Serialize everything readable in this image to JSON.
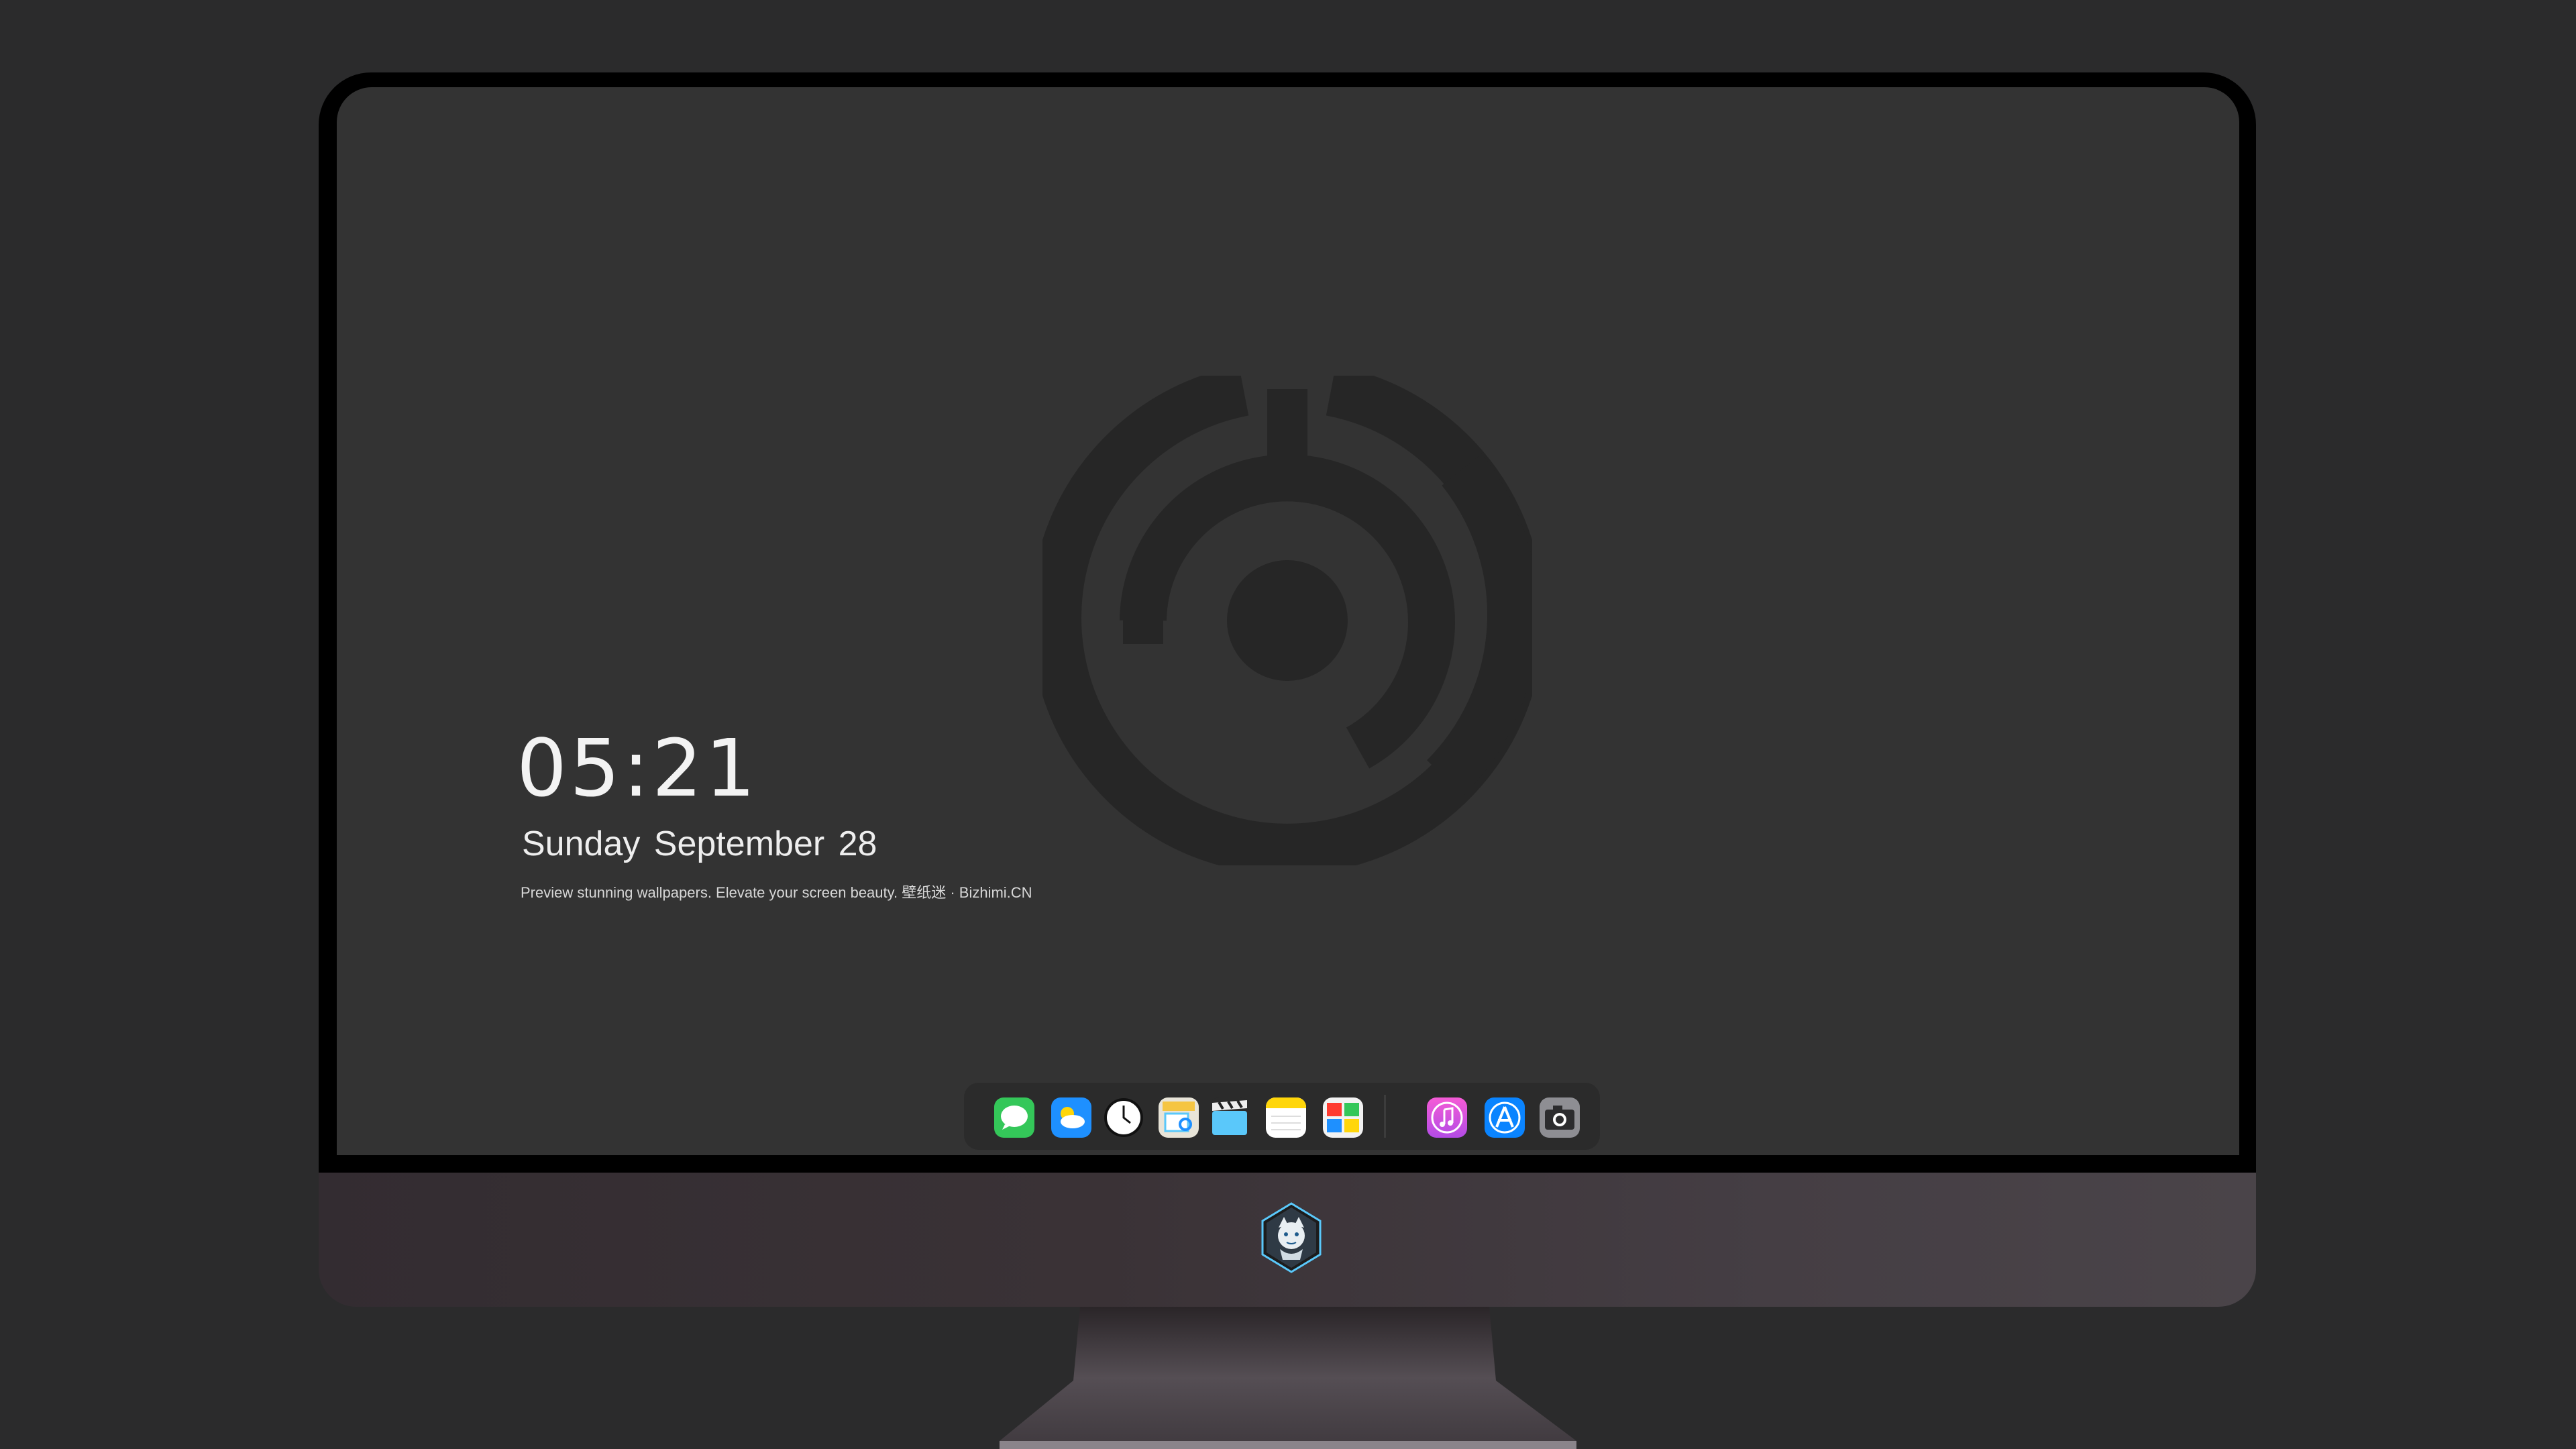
{
  "lock_screen": {
    "time": "05:21",
    "date": "Sunday September  28",
    "tagline": "Preview stunning wallpapers. Elevate your screen beauty. 壁纸迷 · Bizhimi.CN"
  },
  "dock": {
    "apps": [
      {
        "name": "messages-icon",
        "color": "#34c759"
      },
      {
        "name": "weather-icon",
        "color": "#1e90ff"
      },
      {
        "name": "clock-icon",
        "color": "#ffffff"
      },
      {
        "name": "preview-icon",
        "color": "#f5c542"
      },
      {
        "name": "final-cut-icon",
        "color": "#5ac8fa"
      },
      {
        "name": "notes-icon",
        "color": "#ffd60a"
      },
      {
        "name": "photo-booth-icon",
        "color": "#ff3b30"
      },
      {
        "name": "itunes-icon",
        "color": "#d14ee6"
      },
      {
        "name": "app-store-icon",
        "color": "#0a84ff"
      },
      {
        "name": "camera-icon",
        "color": "#8e8e93"
      }
    ]
  },
  "colors": {
    "background": "#2b2b2c",
    "screen": "#333333",
    "wallpaper_logo": "#262626"
  }
}
